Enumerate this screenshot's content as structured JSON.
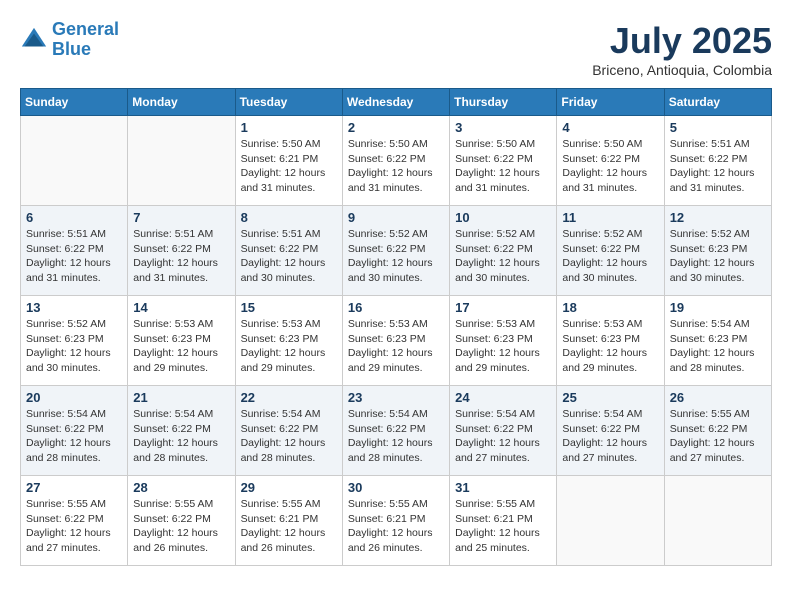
{
  "header": {
    "logo_line1": "General",
    "logo_line2": "Blue",
    "title": "July 2025",
    "subtitle": "Briceno, Antioquia, Colombia"
  },
  "weekdays": [
    "Sunday",
    "Monday",
    "Tuesday",
    "Wednesday",
    "Thursday",
    "Friday",
    "Saturday"
  ],
  "weeks": [
    [
      {
        "day": "",
        "info": ""
      },
      {
        "day": "",
        "info": ""
      },
      {
        "day": "1",
        "info": "Sunrise: 5:50 AM\nSunset: 6:21 PM\nDaylight: 12 hours\nand 31 minutes."
      },
      {
        "day": "2",
        "info": "Sunrise: 5:50 AM\nSunset: 6:22 PM\nDaylight: 12 hours\nand 31 minutes."
      },
      {
        "day": "3",
        "info": "Sunrise: 5:50 AM\nSunset: 6:22 PM\nDaylight: 12 hours\nand 31 minutes."
      },
      {
        "day": "4",
        "info": "Sunrise: 5:50 AM\nSunset: 6:22 PM\nDaylight: 12 hours\nand 31 minutes."
      },
      {
        "day": "5",
        "info": "Sunrise: 5:51 AM\nSunset: 6:22 PM\nDaylight: 12 hours\nand 31 minutes."
      }
    ],
    [
      {
        "day": "6",
        "info": "Sunrise: 5:51 AM\nSunset: 6:22 PM\nDaylight: 12 hours\nand 31 minutes."
      },
      {
        "day": "7",
        "info": "Sunrise: 5:51 AM\nSunset: 6:22 PM\nDaylight: 12 hours\nand 31 minutes."
      },
      {
        "day": "8",
        "info": "Sunrise: 5:51 AM\nSunset: 6:22 PM\nDaylight: 12 hours\nand 30 minutes."
      },
      {
        "day": "9",
        "info": "Sunrise: 5:52 AM\nSunset: 6:22 PM\nDaylight: 12 hours\nand 30 minutes."
      },
      {
        "day": "10",
        "info": "Sunrise: 5:52 AM\nSunset: 6:22 PM\nDaylight: 12 hours\nand 30 minutes."
      },
      {
        "day": "11",
        "info": "Sunrise: 5:52 AM\nSunset: 6:22 PM\nDaylight: 12 hours\nand 30 minutes."
      },
      {
        "day": "12",
        "info": "Sunrise: 5:52 AM\nSunset: 6:23 PM\nDaylight: 12 hours\nand 30 minutes."
      }
    ],
    [
      {
        "day": "13",
        "info": "Sunrise: 5:52 AM\nSunset: 6:23 PM\nDaylight: 12 hours\nand 30 minutes."
      },
      {
        "day": "14",
        "info": "Sunrise: 5:53 AM\nSunset: 6:23 PM\nDaylight: 12 hours\nand 29 minutes."
      },
      {
        "day": "15",
        "info": "Sunrise: 5:53 AM\nSunset: 6:23 PM\nDaylight: 12 hours\nand 29 minutes."
      },
      {
        "day": "16",
        "info": "Sunrise: 5:53 AM\nSunset: 6:23 PM\nDaylight: 12 hours\nand 29 minutes."
      },
      {
        "day": "17",
        "info": "Sunrise: 5:53 AM\nSunset: 6:23 PM\nDaylight: 12 hours\nand 29 minutes."
      },
      {
        "day": "18",
        "info": "Sunrise: 5:53 AM\nSunset: 6:23 PM\nDaylight: 12 hours\nand 29 minutes."
      },
      {
        "day": "19",
        "info": "Sunrise: 5:54 AM\nSunset: 6:23 PM\nDaylight: 12 hours\nand 28 minutes."
      }
    ],
    [
      {
        "day": "20",
        "info": "Sunrise: 5:54 AM\nSunset: 6:22 PM\nDaylight: 12 hours\nand 28 minutes."
      },
      {
        "day": "21",
        "info": "Sunrise: 5:54 AM\nSunset: 6:22 PM\nDaylight: 12 hours\nand 28 minutes."
      },
      {
        "day": "22",
        "info": "Sunrise: 5:54 AM\nSunset: 6:22 PM\nDaylight: 12 hours\nand 28 minutes."
      },
      {
        "day": "23",
        "info": "Sunrise: 5:54 AM\nSunset: 6:22 PM\nDaylight: 12 hours\nand 28 minutes."
      },
      {
        "day": "24",
        "info": "Sunrise: 5:54 AM\nSunset: 6:22 PM\nDaylight: 12 hours\nand 27 minutes."
      },
      {
        "day": "25",
        "info": "Sunrise: 5:54 AM\nSunset: 6:22 PM\nDaylight: 12 hours\nand 27 minutes."
      },
      {
        "day": "26",
        "info": "Sunrise: 5:55 AM\nSunset: 6:22 PM\nDaylight: 12 hours\nand 27 minutes."
      }
    ],
    [
      {
        "day": "27",
        "info": "Sunrise: 5:55 AM\nSunset: 6:22 PM\nDaylight: 12 hours\nand 27 minutes."
      },
      {
        "day": "28",
        "info": "Sunrise: 5:55 AM\nSunset: 6:22 PM\nDaylight: 12 hours\nand 26 minutes."
      },
      {
        "day": "29",
        "info": "Sunrise: 5:55 AM\nSunset: 6:21 PM\nDaylight: 12 hours\nand 26 minutes."
      },
      {
        "day": "30",
        "info": "Sunrise: 5:55 AM\nSunset: 6:21 PM\nDaylight: 12 hours\nand 26 minutes."
      },
      {
        "day": "31",
        "info": "Sunrise: 5:55 AM\nSunset: 6:21 PM\nDaylight: 12 hours\nand 25 minutes."
      },
      {
        "day": "",
        "info": ""
      },
      {
        "day": "",
        "info": ""
      }
    ]
  ]
}
